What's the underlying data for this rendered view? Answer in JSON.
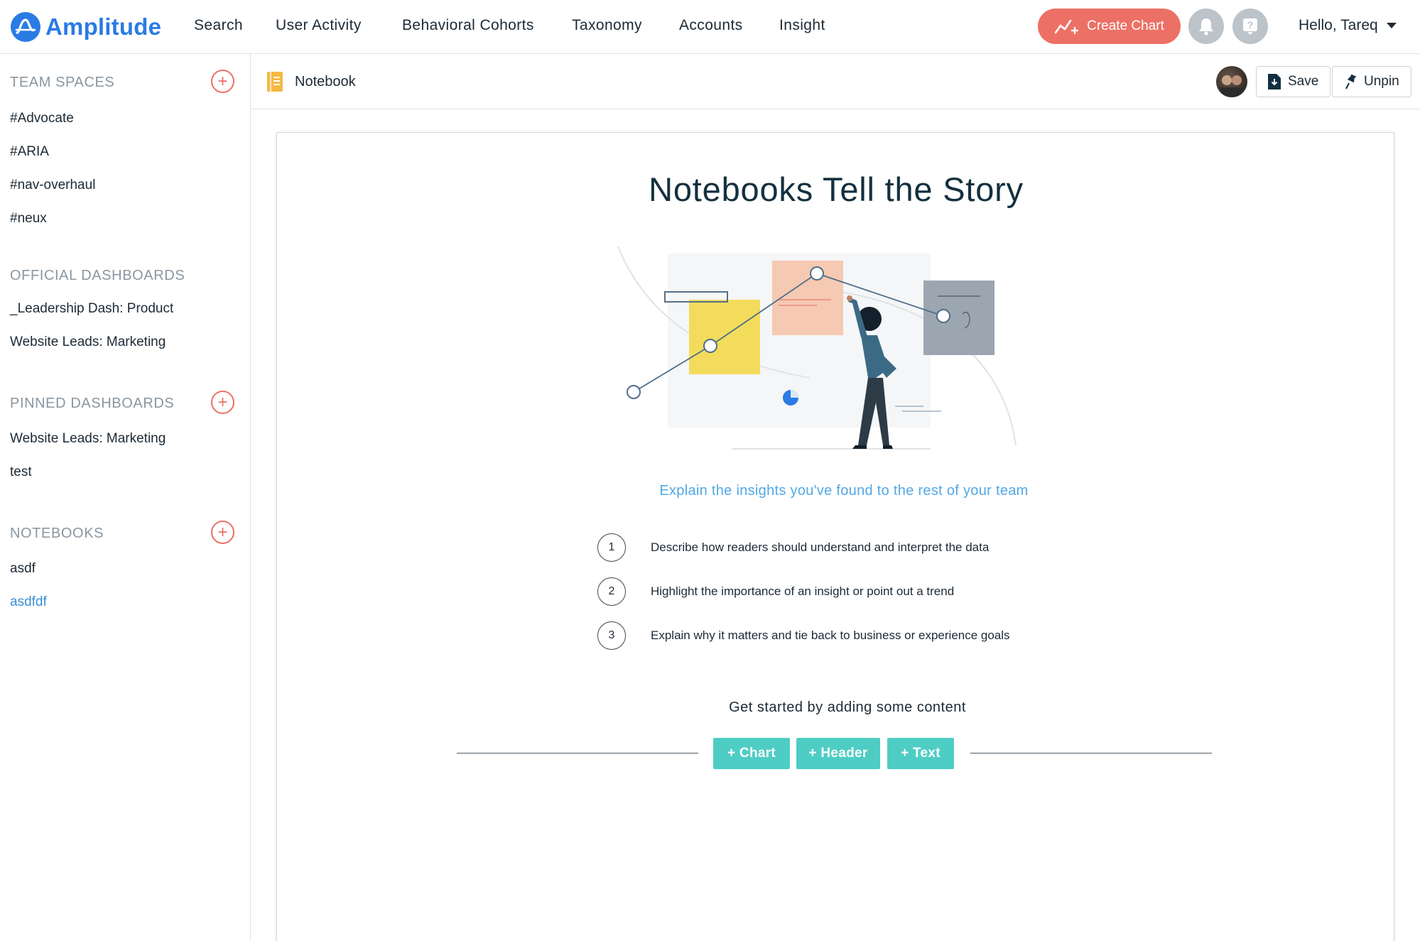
{
  "nav": {
    "brand": "Amplitude",
    "items": [
      "Search",
      "User Activity",
      "Behavioral Cohorts",
      "Taxonomy",
      "Accounts",
      "Insight"
    ],
    "create_chart": "Create Chart",
    "greeting": "Hello, Tareq",
    "icons": {
      "notifications": "bell-icon",
      "help": "help-icon"
    }
  },
  "sidebar": {
    "team_spaces": {
      "title": "TEAM SPACES",
      "items": [
        "#Advocate",
        "#ARIA",
        "#nav-overhaul",
        "#neux"
      ]
    },
    "official_dashboards": {
      "title": "OFFICIAL DASHBOARDS",
      "items": [
        "_Leadership Dash: Product",
        "Website Leads: Marketing"
      ]
    },
    "pinned_dashboards": {
      "title": "PINNED DASHBOARDS",
      "items": [
        "Website Leads: Marketing",
        "test"
      ]
    },
    "notebooks": {
      "title": "NOTEBOOKS",
      "items": [
        "asdf",
        "asdfdf"
      ],
      "active": "asdfdf"
    }
  },
  "header": {
    "title": "Notebook",
    "save": "Save",
    "unpin": "Unpin"
  },
  "main": {
    "title": "Notebooks Tell the Story",
    "subtitle": "Explain the insights you've found to the rest of your team",
    "steps": [
      {
        "num": "1",
        "text": "Describe how readers should understand and interpret the data"
      },
      {
        "num": "2",
        "text": "Highlight the importance of an insight or point out a trend"
      },
      {
        "num": "3",
        "text": "Explain why it matters and tie back to business or experience goals"
      }
    ],
    "get_started": "Get started by adding some content",
    "buttons": {
      "chart": "+ Chart",
      "header": "+ Header",
      "text": "+ Text"
    }
  },
  "colors": {
    "brand_blue": "#2a7be4",
    "accent_coral": "#ec7065",
    "teal": "#4ecdc4",
    "link_blue": "#52a8e6"
  }
}
